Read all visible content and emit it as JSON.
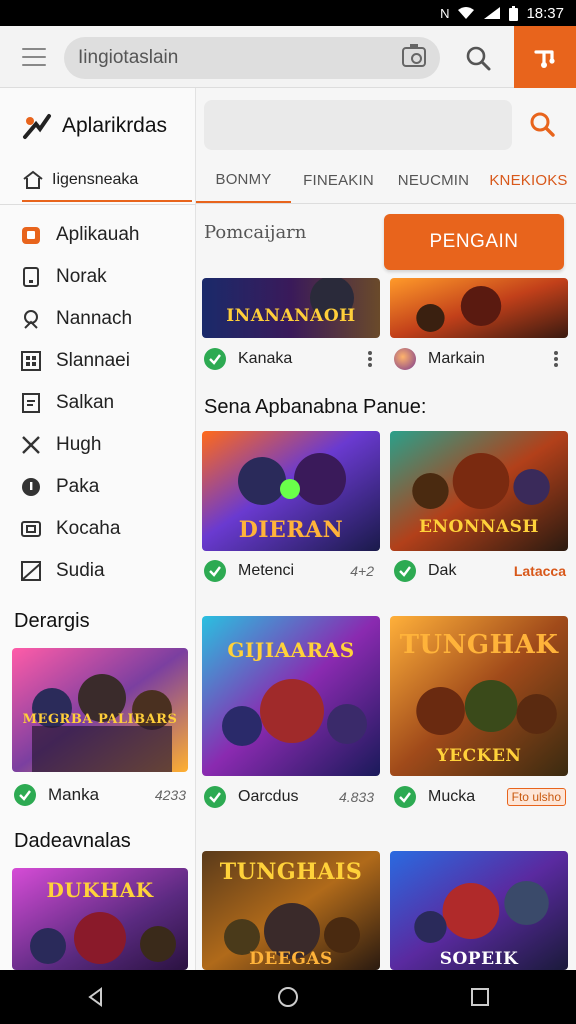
{
  "status_bar": {
    "time": "18:37",
    "icons": [
      "nfc-icon",
      "wifi-icon",
      "signal-icon",
      "battery-icon"
    ]
  },
  "appbar": {
    "search_value": "Iingiotaslain"
  },
  "sidebar": {
    "brand": "Aplarikrdas",
    "tab_label": "Iigensneaka",
    "items": [
      {
        "label": "Aplikauah",
        "icon": "badge-icon"
      },
      {
        "label": "Norak",
        "icon": "phone-icon"
      },
      {
        "label": "Nannach",
        "icon": "shield-person-icon"
      },
      {
        "label": "Slannaei",
        "icon": "grid-icon"
      },
      {
        "label": "Salkan",
        "icon": "document-icon"
      },
      {
        "label": "Hugh",
        "icon": "crossed-swords-icon"
      },
      {
        "label": "Paka",
        "icon": "info-circle-icon"
      },
      {
        "label": "Kocaha",
        "icon": "tv-icon"
      },
      {
        "label": "Sudia",
        "icon": "image-icon"
      }
    ],
    "section1": "Derargis",
    "section1_card": {
      "name": "Manka",
      "value": "4233",
      "art_title": "MEGRBA PALIBARS"
    },
    "section2": "Dadeavnalas",
    "section2_card": {
      "art_title": "DUKHAK"
    }
  },
  "main": {
    "tabs": [
      "BONMY",
      "FINEAKIN",
      "NEUCMIN",
      "KNEKIOKS"
    ],
    "hint": "Pomcaijarn",
    "cta": "PENGAIN",
    "top_cards": [
      {
        "name": "Kanaka",
        "art_title": "INANANAOH"
      },
      {
        "name": "Markain",
        "art_title": ""
      }
    ],
    "section_title": "Sena Apbanabna Panue:",
    "grid": [
      {
        "name": "Metenci",
        "value": "4+2",
        "art_title": "DIERAN"
      },
      {
        "name": "Dak",
        "value": "Latacca",
        "art_title": "ENONNASH"
      },
      {
        "name": "Oarcdus",
        "value": "4.833",
        "art_title": "GIJIAARAS"
      },
      {
        "name": "Mucka",
        "value": "Fto ulsho",
        "art_title": "TUNGHAK",
        "art_sub": "YECKEN"
      },
      {
        "name": "",
        "value": "",
        "art_title": "TUNGHAIS",
        "art_sub": "DEEGAS"
      },
      {
        "name": "",
        "value": "",
        "art_title": "",
        "art_sub": "SOPEIK"
      }
    ]
  },
  "colors": {
    "accent": "#e8641c",
    "check": "#2daa52"
  }
}
